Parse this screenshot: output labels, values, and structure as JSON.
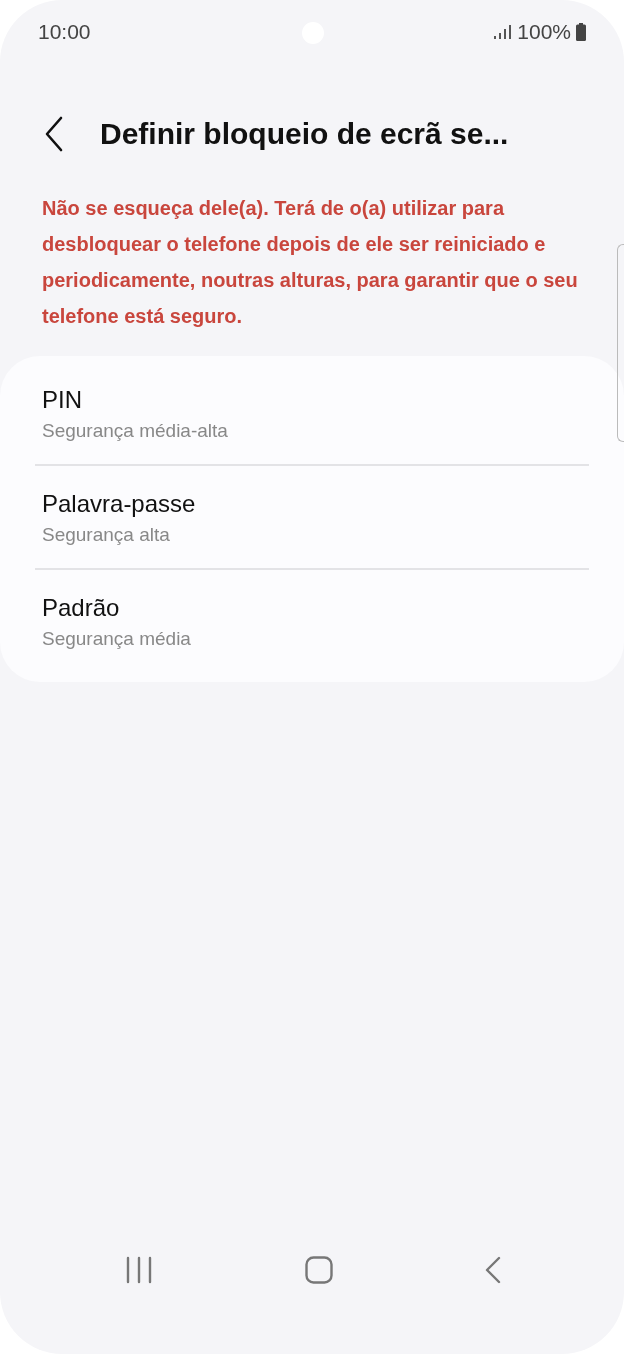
{
  "status_bar": {
    "time": "10:00",
    "battery": "100%"
  },
  "header": {
    "title": "Definir bloqueio de ecrã se..."
  },
  "warning": "Não se esqueça dele(a). Terá de o(a) utilizar para desbloquear o telefone depois de ele ser reiniciado e periodicamente, noutras alturas, para garantir que o seu telefone está seguro.",
  "options": [
    {
      "title": "PIN",
      "subtitle": "Segurança média-alta"
    },
    {
      "title": "Palavra-passe",
      "subtitle": "Segurança alta"
    },
    {
      "title": "Padrão",
      "subtitle": "Segurança média"
    }
  ]
}
